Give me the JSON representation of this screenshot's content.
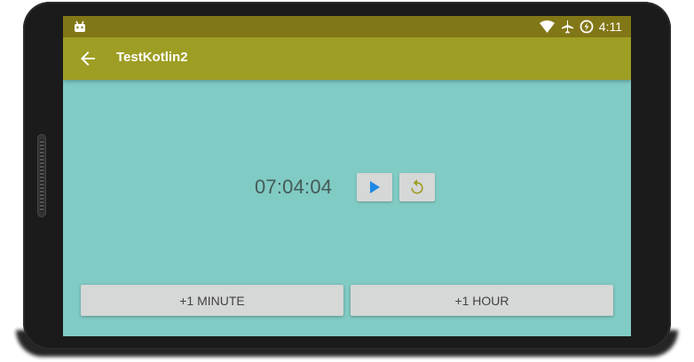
{
  "status_bar": {
    "time": "4:11",
    "icons": [
      "android-debug-icon",
      "wifi-icon",
      "airplane-icon",
      "battery-charging-icon"
    ]
  },
  "app_bar": {
    "title": "TestKotlin2",
    "back_icon": "arrow-back-icon"
  },
  "timer": {
    "display": "07:04:04"
  },
  "controls": {
    "play_icon": "play-icon",
    "reset_icon": "replay-icon"
  },
  "buttons": {
    "add_minute": "+1 MINUTE",
    "add_hour": "+1 HOUR"
  },
  "colors": {
    "status_bar": "#827717",
    "app_bar": "#9e9d24",
    "background": "#80cbc4",
    "button": "#d6d7d7",
    "play_accent": "#1e88e5",
    "reset_accent": "#9e9d24"
  }
}
